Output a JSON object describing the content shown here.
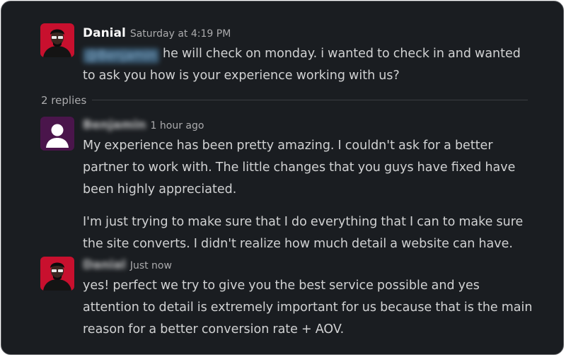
{
  "messages": [
    {
      "author": "Danial",
      "timestamp": "Saturday at 4:19 PM",
      "mention": "@Benjamin",
      "paragraphs": [
        "he will check on monday. i wanted to check in and wanted to ask you how is your experience working with us?"
      ]
    },
    {
      "author": "Benjamin",
      "timestamp": "1 hour ago",
      "paragraphs": [
        "My experience has been pretty amazing. I couldn't ask for a better partner to work with. The little changes that you guys have fixed have been highly appreciated.",
        "I'm just trying to make sure that I do everything that I can to make sure the site converts. I didn't realize how much detail a website can have."
      ]
    },
    {
      "author": "Danial",
      "timestamp": "Just now",
      "paragraphs": [
        "yes! perfect we try to give you the best service possible and yes attention to detail is extremely important for us because that is the main reason for a better conversion rate + AOV."
      ]
    }
  ],
  "thread": {
    "replies_label": "2 replies"
  },
  "colors": {
    "background": "#1a1d21",
    "text": "#d1d2d3",
    "muted": "#ababad",
    "mention_bg": "#3a5d78",
    "avatar_purple": "#4a154b",
    "avatar_red": "#c8102e"
  },
  "icons": {
    "avatar_danial": "user-photo-avatar",
    "avatar_benjamin": "default-user-icon"
  }
}
